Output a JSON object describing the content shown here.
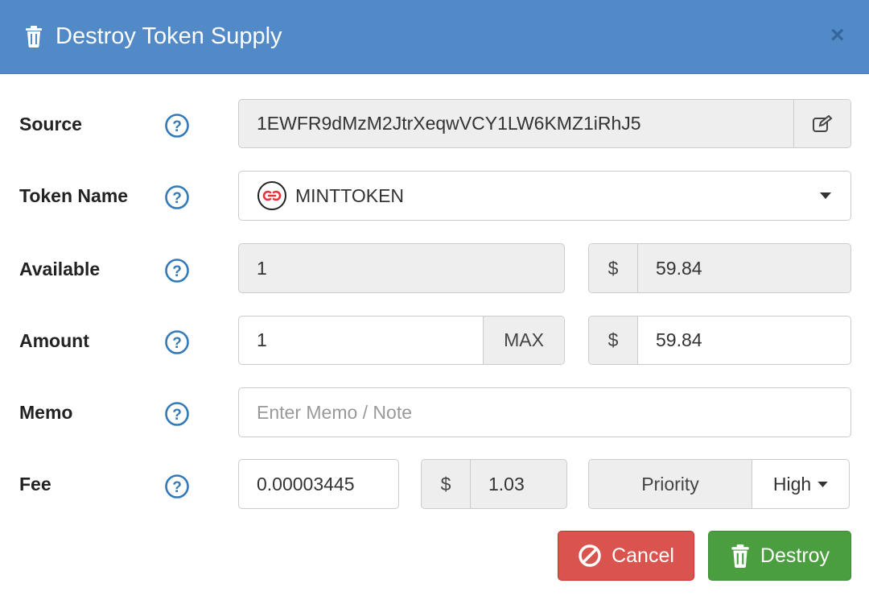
{
  "modal": {
    "title": "Destroy Token Supply",
    "close_label": "×",
    "header_color": "#528ac7"
  },
  "form": {
    "source": {
      "label": "Source",
      "value": "1EWFR9dMzM2JtrXeqwVCY1LW6KMZ1iRhJ5"
    },
    "token_name": {
      "label": "Token Name",
      "value": "MINTTOKEN",
      "icon": "token-logo-icon"
    },
    "available": {
      "label": "Available",
      "amount": "1",
      "currency_symbol": "$",
      "usd_value": "59.84"
    },
    "amount": {
      "label": "Amount",
      "value": "1",
      "max_label": "MAX",
      "currency_symbol": "$",
      "usd_value": "59.84"
    },
    "memo": {
      "label": "Memo",
      "value": "",
      "placeholder": "Enter Memo / Note"
    },
    "fee": {
      "label": "Fee",
      "value": "0.00003445",
      "currency_symbol": "$",
      "usd_value": "1.03",
      "priority_label": "Priority",
      "priority_value": "High"
    }
  },
  "buttons": {
    "cancel_label": "Cancel",
    "destroy_label": "Destroy"
  },
  "colors": {
    "cancel": "#d9534f",
    "destroy": "#4a9e3f",
    "help_icon": "#337ab7",
    "token_logo": "#e8353a"
  }
}
